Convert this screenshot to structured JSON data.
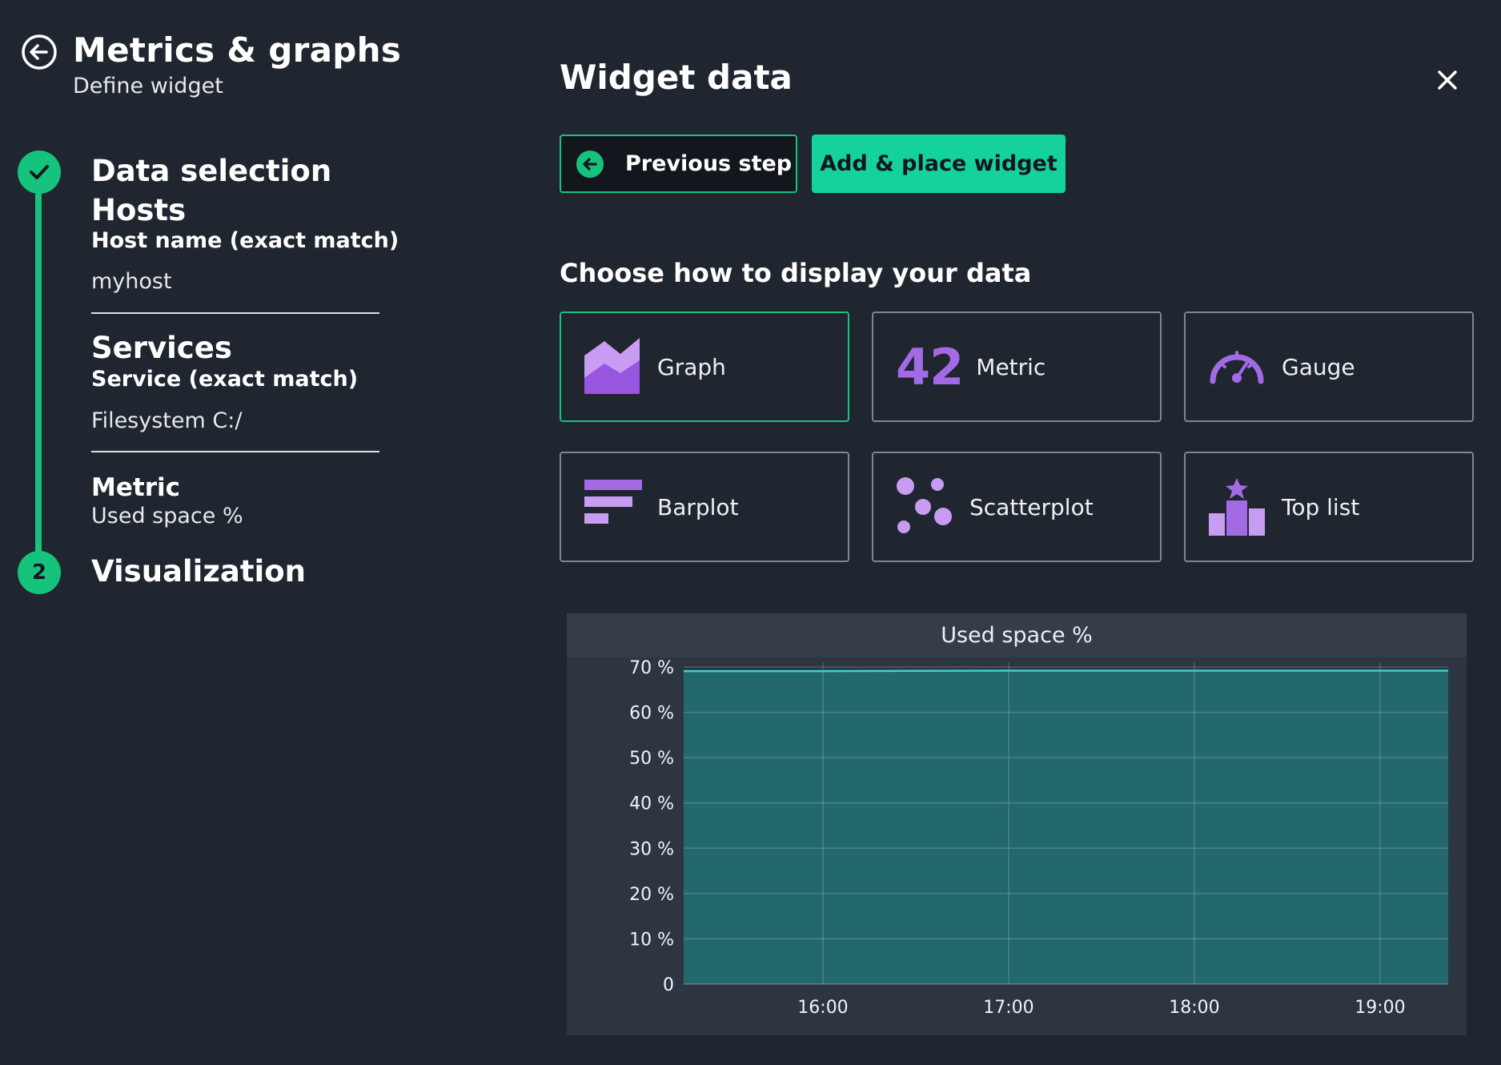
{
  "header": {
    "title": "Metrics & graphs",
    "subtitle": "Define widget"
  },
  "steps": {
    "step1": {
      "title": "Data selection",
      "hosts_heading": "Hosts",
      "hosts_label": "Host name (exact match)",
      "hosts_value": "myhost",
      "services_heading": "Services",
      "services_label": "Service (exact match)",
      "services_value": "Filesystem C:/",
      "metric_heading": "Metric",
      "metric_value": "Used space %"
    },
    "step2": {
      "number": "2",
      "title": "Visualization"
    }
  },
  "panel": {
    "title": "Widget data",
    "prev_button": "Previous step",
    "add_button": "Add & place widget",
    "choose_title": "Choose how to display your data"
  },
  "viz_options": [
    {
      "label": "Graph",
      "icon": "graph-icon",
      "selected": true
    },
    {
      "label": "Metric",
      "icon": "metric-icon",
      "icon_text": "42"
    },
    {
      "label": "Gauge",
      "icon": "gauge-icon"
    },
    {
      "label": "Barplot",
      "icon": "barplot-icon"
    },
    {
      "label": "Scatterplot",
      "icon": "scatterplot-icon"
    },
    {
      "label": "Top list",
      "icon": "top-list-icon"
    }
  ],
  "colors": {
    "accent": "#15c37d",
    "accent_button": "#15d19a",
    "icon_purple": "#a36ae6",
    "chart_fill": "#23686c",
    "chart_line": "#3fd0d6",
    "background": "#20262f"
  },
  "chart_data": {
    "type": "area",
    "title": "Used space %",
    "ylim": [
      0,
      70
    ],
    "yticks": [
      {
        "value": 70,
        "label": "70 %"
      },
      {
        "value": 60,
        "label": "60 %"
      },
      {
        "value": 50,
        "label": "50 %"
      },
      {
        "value": 40,
        "label": "40 %"
      },
      {
        "value": 30,
        "label": "30 %"
      },
      {
        "value": 20,
        "label": "20 %"
      },
      {
        "value": 10,
        "label": "10 %"
      },
      {
        "value": 0,
        "label": "0"
      }
    ],
    "xlim": [
      "15:15",
      "19:22"
    ],
    "xticks": [
      "16:00",
      "17:00",
      "18:00",
      "19:00"
    ],
    "x": [
      "15:15",
      "16:00",
      "17:00",
      "18:00",
      "19:00",
      "19:22"
    ],
    "series": [
      {
        "values": [
          69.1,
          69.1,
          69.2,
          69.2,
          69.2,
          69.2
        ]
      }
    ],
    "grid": true
  }
}
